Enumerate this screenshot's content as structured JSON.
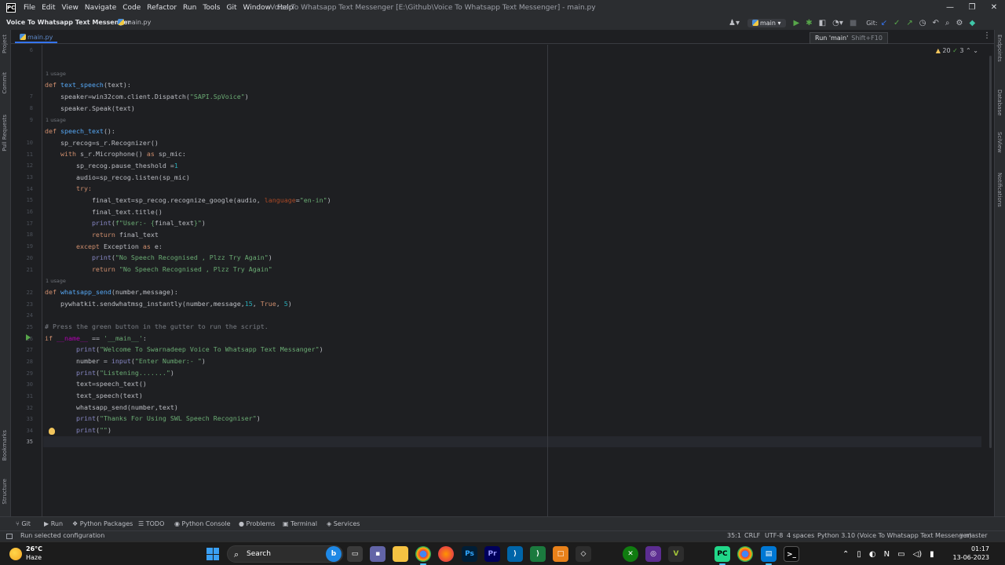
{
  "titlebar": {
    "logo": "PC",
    "menu": [
      "File",
      "Edit",
      "View",
      "Navigate",
      "Code",
      "Refactor",
      "Run",
      "Tools",
      "Git",
      "Window",
      "Help"
    ],
    "window_title": "Voice To Whatsapp Text Messenger [E:\\Github\\Voice To Whatsapp Text Messenger] - main.py",
    "controls": {
      "minimize": "—",
      "restore": "❐",
      "close": "✕"
    }
  },
  "navbar": {
    "project": "Voice To Whatsapp Text Messenger",
    "file": "main.py",
    "run_config": "main",
    "git_label": "Git:"
  },
  "tooltip": {
    "text": "Run 'main'",
    "shortcut": "Shift+F10"
  },
  "tab": {
    "label": "main.py"
  },
  "left_strip": [
    "Project",
    "Commit",
    "Pull Requests",
    "Bookmarks",
    "Structure"
  ],
  "right_strip": [
    "Endpoints",
    "Database",
    "SciView",
    "Notifications"
  ],
  "inspection": {
    "warnings": "20",
    "weak": "3"
  },
  "editor": {
    "lines": [
      {
        "n": "6"
      },
      {
        "n": "7"
      },
      {
        "n": "8"
      },
      {
        "n": "9"
      },
      {
        "n": "10"
      },
      {
        "n": "11"
      },
      {
        "n": "12"
      },
      {
        "n": "13"
      },
      {
        "n": "14"
      },
      {
        "n": "15"
      },
      {
        "n": "16"
      },
      {
        "n": "17"
      },
      {
        "n": "18"
      },
      {
        "n": "19"
      },
      {
        "n": "20"
      },
      {
        "n": "21"
      },
      {
        "n": "22"
      },
      {
        "n": "23"
      },
      {
        "n": "24"
      },
      {
        "n": "25"
      },
      {
        "n": "26"
      },
      {
        "n": "27"
      },
      {
        "n": "28"
      },
      {
        "n": "29"
      },
      {
        "n": "30"
      },
      {
        "n": "31"
      },
      {
        "n": "32"
      },
      {
        "n": "33"
      },
      {
        "n": "34"
      },
      {
        "n": "35"
      }
    ],
    "usage_hint": "1 usage",
    "code": {
      "l6_def": "def ",
      "l6_fn": "text_speech",
      "l6_rest": "(text):",
      "l7": "    speaker=win32com.client.Dispatch(",
      "l7_str": "\"SAPI.SpVoice\"",
      "l7_end": ")",
      "l8": "    speaker.Speak(text)",
      "l9_def": "def ",
      "l9_fn": "speech_text",
      "l9_rest": "():",
      "l10": "    sp_recog=s_r.Recognizer()",
      "l11_kw": "    with ",
      "l11_mid": "s_r.Microphone() ",
      "l11_as": "as ",
      "l11_end": "sp_mic:",
      "l12": "        sp_recog.pause_theshold =",
      "l12_num": "1",
      "l13": "        audio=sp_recog.listen(sp_mic)",
      "l14_kw": "        try:",
      "l15": "            final_text=sp_recog.recognize_google(audio, ",
      "l15_prm": "language",
      "l15_eq": "=",
      "l15_str": "\"en-in\"",
      "l15_end": ")",
      "l16": "            final_text.title()",
      "l17_bi": "            print",
      "l17_p": "(",
      "l17_str": "f\"User:- {",
      "l17_var": "final_text",
      "l17_str2": "}\"",
      "l17_end": ")",
      "l18_kw": "            return ",
      "l18_end": "final_text",
      "l19_kw": "        except ",
      "l19_cls": "Exception ",
      "l19_as": "as ",
      "l19_end": "e:",
      "l20_bi": "            print",
      "l20_p": "(",
      "l20_str": "\"No Speech Recognised , Plzz Try Again\"",
      "l20_end": ")",
      "l21_kw": "            return ",
      "l21_str": "\"No Speech Recognised , Plzz Try Again\"",
      "l22_def": "def ",
      "l22_fn": "whatsapp_send",
      "l22_rest": "(number,message):",
      "l23": "    pywhatkit.sendwhatmsg_instantly(number,message,",
      "l23_num1": "15",
      "l23_c": ", ",
      "l23_kw": "True",
      "l23_c2": ", ",
      "l23_num2": "5",
      "l23_end": ")",
      "l24": "",
      "l25_cmt": "# Press the green button in the gutter to run the script.",
      "l26_kw": "if ",
      "l26_dun": "__name__",
      "l26_mid": " == ",
      "l26_str": "'__main__'",
      "l26_end": ":",
      "l27_bi": "        print",
      "l27_p": "(",
      "l27_str": "\"Welcome To Swarnadeep Voice To Whatsapp Text Messanger\"",
      "l27_end": ")",
      "l28": "        number = ",
      "l28_bi": "input",
      "l28_p": "(",
      "l28_str": "\"Enter Number:- \"",
      "l28_end": ")",
      "l29_bi": "        print",
      "l29_p": "(",
      "l29_str": "\"Listening.......\"",
      "l29_end": ")",
      "l30": "        text=speech_text()",
      "l31": "        text_speech(text)",
      "l32": "        whatsapp_send(number,text)",
      "l33_bi": "        print",
      "l33_p": "(",
      "l33_str": "\"Thanks For Using SWL Speech Recogniser\"",
      "l33_end": ")",
      "l34_bi": "        print",
      "l34_p": "(",
      "l34_str": "\"\"",
      "l34_end": ")",
      "l35": ""
    }
  },
  "toolwindows": [
    "Git",
    "Run",
    "Python Packages",
    "TODO",
    "Python Console",
    "Problems",
    "Terminal",
    "Services"
  ],
  "statusbar": {
    "message": "Run selected configuration",
    "position": "35:1",
    "line_sep": "CRLF",
    "encoding": "UTF-8",
    "indent": "4 spaces",
    "interpreter": "Python 3.10 (Voice To Whatsapp Text Messenger)",
    "branch": "master"
  },
  "taskbar": {
    "temp": "26°C",
    "weather": "Haze",
    "search_label": "Search",
    "time": "01:17",
    "date": "13-06-2023",
    "apps": [
      "Ps",
      "Pr"
    ]
  }
}
